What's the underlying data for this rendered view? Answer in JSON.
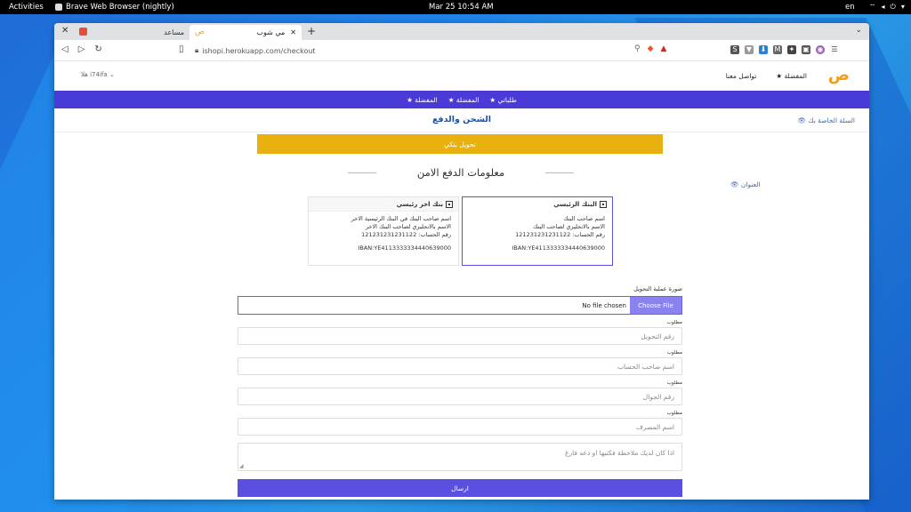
{
  "desktop": {
    "activities": "Activities",
    "app_name": "Brave Web Browser (nightly)",
    "clock": "Mar 25  10:54 AM",
    "lang": "en"
  },
  "browser": {
    "tabs": [
      {
        "title": "مساعد"
      },
      {
        "title": "مي شوب"
      }
    ],
    "url": "ishopi.herokuapp.com/checkout",
    "ext_icons": [
      "S",
      "▼",
      "⬇",
      "M",
      "✦",
      "▣",
      "◉"
    ]
  },
  "site": {
    "logo": "ص",
    "header_links": [
      "★ المفضلة",
      "تواصل معنا"
    ],
    "user_menu": "هلا i74ifa ⌄",
    "nav_items": [
      "★ طلباتي",
      "★ المفضلة",
      "★ المفضلة"
    ],
    "page_title": "الشحن والدفع",
    "cart_link": "👁 السلة الخاصة بك",
    "alert": "تحويل بنكي",
    "section_title": "معلومات الدفع الامن",
    "address_link": "👁 العنوان",
    "banks": [
      {
        "title": "البنك الرئيسي",
        "lines": [
          "اسم صاحب البنك",
          "الاسم بالانجليزي لصاحب البنك",
          "رقم الحساب: 121231231231122"
        ],
        "iban": "IBAN:YE4113333334440639000",
        "selected": true
      },
      {
        "title": "بنك اخر رئيسي",
        "lines": [
          "اسم صاحب البنك في البنك الرئيسية الاخر",
          "الاسم بالانجليزي لصاحب البنك الاخر",
          "رقم الحساب: 121231231231122"
        ],
        "iban": "IBAN:YE4113333334440639000",
        "selected": false
      }
    ],
    "form": {
      "file_label": "صورة عملية التحويل",
      "file_button": "Choose File",
      "file_status": "No file chosen",
      "required": "مطلوب",
      "fields": [
        "رقم التحويل",
        "اسم صاحب الحساب",
        "رقم الجوال",
        "اسم المصرف"
      ],
      "notes_placeholder": "اذا كان لديك ملاحظة فكتبها او دعه فارغ",
      "submit": "ارسال"
    }
  }
}
